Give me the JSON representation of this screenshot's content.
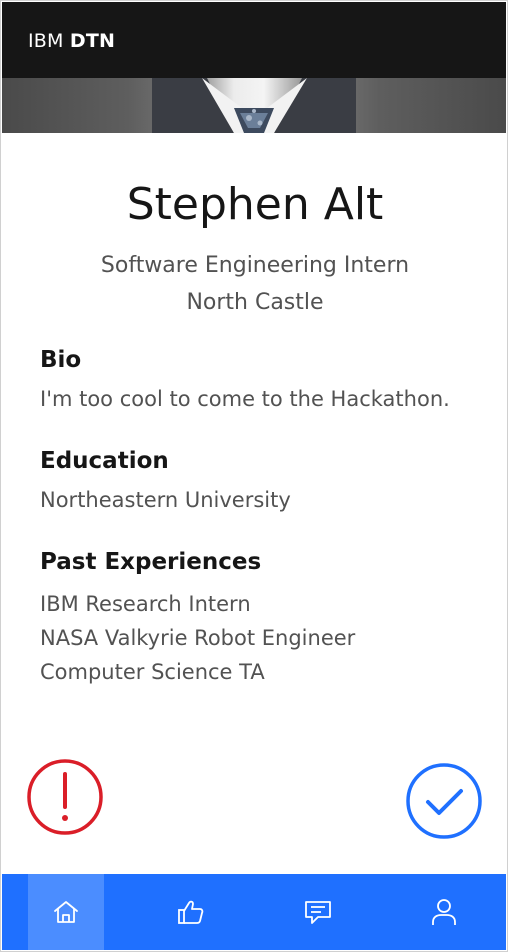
{
  "app": {
    "brand_prefix": "IBM",
    "brand_name": "DTN"
  },
  "profile": {
    "name": "Stephen Alt",
    "role": "Software Engineering Intern",
    "location": "North Castle"
  },
  "sections": {
    "bio": {
      "title": "Bio",
      "text": "I'm too cool to come to the Hackathon."
    },
    "education": {
      "title": "Education",
      "text": "Northeastern University"
    },
    "experience": {
      "title": "Past Experiences",
      "items": [
        "IBM Research Intern",
        "NASA Valkyrie Robot Engineer",
        "Computer Science TA"
      ]
    }
  },
  "actions": {
    "reject_icon": "exclamation-circle-icon",
    "accept_icon": "checkmark-circle-icon",
    "reject_color": "#da1e28",
    "accept_color": "#1f70ff"
  },
  "tabbar": {
    "color": "#1f70ff",
    "active_tab": "home",
    "tabs": [
      {
        "id": "home",
        "icon": "home-icon"
      },
      {
        "id": "likes",
        "icon": "thumbs-up-icon"
      },
      {
        "id": "messages",
        "icon": "chat-icon"
      },
      {
        "id": "profile",
        "icon": "user-icon"
      }
    ]
  }
}
